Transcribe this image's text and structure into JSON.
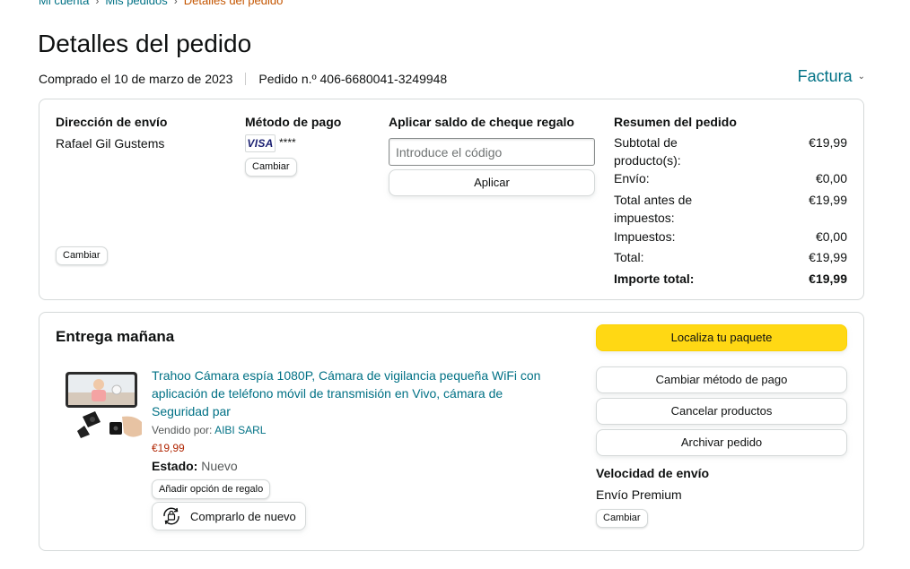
{
  "breadcrumb": {
    "items": [
      "Mi cuenta",
      "Mis pedidos"
    ],
    "current": "Detalles del pedido"
  },
  "page": {
    "title": "Detalles del pedido",
    "ordered_on": "Comprado el 10 de marzo de 2023",
    "order_number": "Pedido n.º 406-6680041-3249948",
    "invoice": "Factura"
  },
  "shipping": {
    "title": "Dirección de envío",
    "name": "Rafael Gil Gustems",
    "change": "Cambiar"
  },
  "payment": {
    "title": "Método de pago",
    "card_brand": "VISA",
    "card_digits": "****",
    "change": "Cambiar"
  },
  "gift_card": {
    "title": "Aplicar saldo de cheque regalo",
    "placeholder": "Introduce el código",
    "apply": "Aplicar"
  },
  "summary": {
    "title": "Resumen del pedido",
    "rows": [
      {
        "label": "Subtotal de producto(s):",
        "value": "€19,99"
      },
      {
        "label": "Envío:",
        "value": "€0,00"
      },
      {
        "label": "Total antes de impuestos:",
        "value": "€19,99"
      },
      {
        "label": "Impuestos:",
        "value": "€0,00"
      },
      {
        "label": "Total:",
        "value": "€19,99"
      },
      {
        "label": "Importe total:",
        "value": "€19,99"
      }
    ]
  },
  "delivery": {
    "title": "Entrega mañana",
    "product": {
      "title": "Trahoo Cámara espía 1080P, Cámara de vigilancia pequeña WiFi con aplicación de teléfono móvil de transmisión en Vivo, cámara de Seguridad par",
      "sold_by_label": "Vendido por:",
      "seller": "AIBI SARL",
      "price": "€19,99",
      "state_label": "Estado:",
      "state_value": "Nuevo",
      "gift_option": "Añadir opción de regalo",
      "buy_again": "Comprarlo de nuevo"
    },
    "actions": {
      "track": "Localiza tu paquete",
      "change_payment": "Cambiar método de pago",
      "cancel": "Cancelar productos",
      "archive": "Archivar pedido"
    },
    "shipping_speed": {
      "title": "Velocidad de envío",
      "value": "Envío Premium",
      "change": "Cambiar"
    }
  },
  "colors": {
    "link": "#007185",
    "primary_button": "#FFD814",
    "price": "#B12704",
    "breadcrumb_current": "#C45500"
  }
}
